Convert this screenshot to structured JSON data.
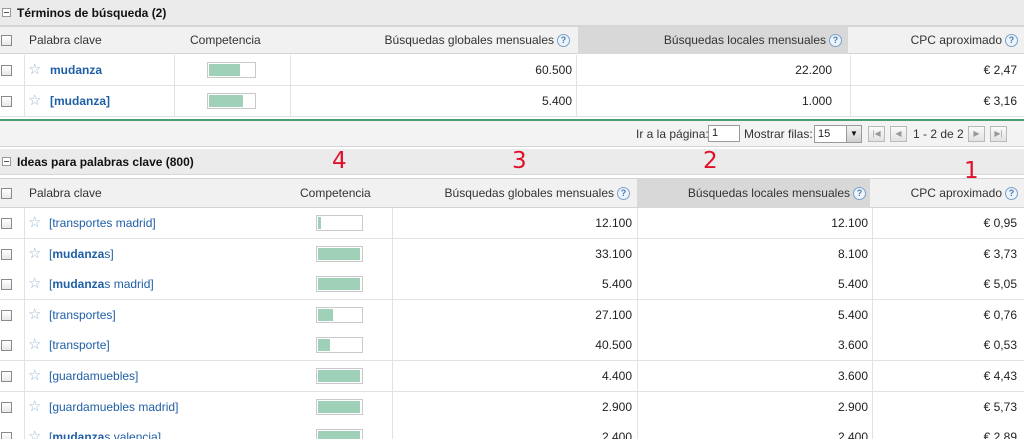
{
  "section1": {
    "title": "Términos de búsqueda (2)",
    "columns": {
      "keyword": "Palabra clave",
      "competition": "Competencia",
      "global": "Búsquedas globales mensuales",
      "local": "Búsquedas locales mensuales",
      "cpc": "CPC aproximado"
    },
    "rows": [
      {
        "keyword": "mudanza",
        "competition": 0.65,
        "global": "60.500",
        "local": "22.200",
        "cpc": "€ 2,47"
      },
      {
        "keyword": "[mudanza]",
        "competition": 0.72,
        "global": "5.400",
        "local": "1.000",
        "cpc": "€ 3,16"
      }
    ]
  },
  "pager": {
    "go_to_page_label": "Ir a la página:",
    "page_value": "1",
    "show_rows_label": "Mostrar filas:",
    "rows_value": "15",
    "range_text": "1 - 2 de 2"
  },
  "section2": {
    "title": "Ideas para palabras clave (800)",
    "columns": {
      "keyword": "Palabra clave",
      "competition": "Competencia",
      "global": "Búsquedas globales mensuales",
      "local": "Búsquedas locales mensuales",
      "cpc": "CPC aproximado"
    },
    "rows": [
      {
        "prefix": "",
        "bold": "",
        "suffix": "[transportes madrid]",
        "competition": 0.06,
        "global": "12.100",
        "local": "12.100",
        "cpc": "€ 0,95"
      },
      {
        "prefix": "[",
        "bold": "mudanza",
        "suffix": "s]",
        "competition": 0.93,
        "global": "33.100",
        "local": "8.100",
        "cpc": "€ 3,73"
      },
      {
        "prefix": "[",
        "bold": "mudanza",
        "suffix": "s madrid]",
        "competition": 0.93,
        "global": "5.400",
        "local": "5.400",
        "cpc": "€ 5,05"
      },
      {
        "prefix": "",
        "bold": "",
        "suffix": "[transportes]",
        "competition": 0.33,
        "global": "27.100",
        "local": "5.400",
        "cpc": "€ 0,76"
      },
      {
        "prefix": "",
        "bold": "",
        "suffix": "[transporte]",
        "competition": 0.26,
        "global": "40.500",
        "local": "3.600",
        "cpc": "€ 0,53"
      },
      {
        "prefix": "",
        "bold": "",
        "suffix": "[guardamuebles]",
        "competition": 0.93,
        "global": "4.400",
        "local": "3.600",
        "cpc": "€ 4,43"
      },
      {
        "prefix": "",
        "bold": "",
        "suffix": "[guardamuebles madrid]",
        "competition": 0.93,
        "global": "2.900",
        "local": "2.900",
        "cpc": "€ 5,73"
      },
      {
        "prefix": "[",
        "bold": "mudanza",
        "suffix": "s valencia]",
        "competition": 0.93,
        "global": "2.400",
        "local": "2.400",
        "cpc": "€ 2,89"
      }
    ]
  },
  "annotations": [
    "4",
    "3",
    "2",
    "1"
  ],
  "icons": {
    "star": "star-icon",
    "help": "help-icon",
    "collapse": "collapse-icon"
  },
  "colors": {
    "competition_fill": "#9fd0b8",
    "keyword_link": "#1f5fa6",
    "annotation": "#e0102a",
    "divider_green": "#4aa070"
  }
}
